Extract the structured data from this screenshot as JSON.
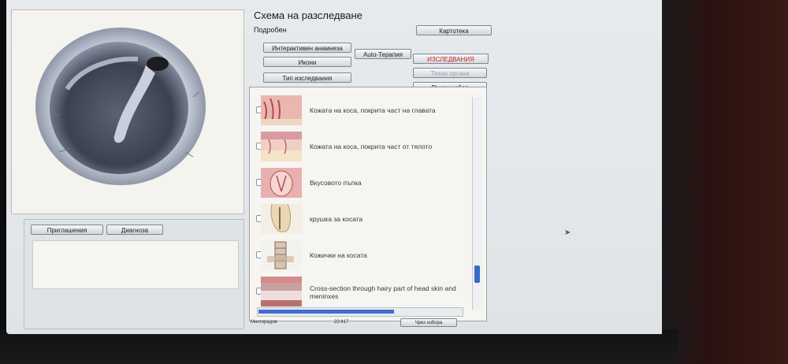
{
  "header": {
    "title": "Схема на разследване",
    "subtitle": "Подробен",
    "card_index_button": "Картотека"
  },
  "toolbar": {
    "interactive_anamnesis": "Интерактивен анамнеза",
    "auto_therapy": "Auto-Терапия",
    "investigations": "ИЗСЛЕДВАНИЯ",
    "icons": "Икони",
    "by_organ": "Тяхно органи",
    "study_type": "Тип изследвания",
    "manual_select": "Ръчен избор"
  },
  "lower_panel": {
    "complaints_button": "Приглашения",
    "diagnosis_button": "Диагноза"
  },
  "list": {
    "items": [
      {
        "label": "Кожата на коса, покрита част на главата",
        "thumb": "scalp-skin"
      },
      {
        "label": "Кожата на коса, покрита част от тялото",
        "thumb": "body-skin"
      },
      {
        "label": "Вкусовото пъпка",
        "thumb": "taste-bud"
      },
      {
        "label": "крушка за косата",
        "thumb": "hair-bulb"
      },
      {
        "label": "Кожички на косата",
        "thumb": "hair-cuticle"
      },
      {
        "label": "Cross-section through hairy part of head skin and meninxes",
        "thumb": "head-cross-section"
      }
    ]
  },
  "status": {
    "left": "Многоредов",
    "center": "22:417",
    "right_button": "Чрез избора"
  },
  "colors": {
    "accent_red": "#d22020",
    "scroll_blue": "#3f6fd0"
  }
}
